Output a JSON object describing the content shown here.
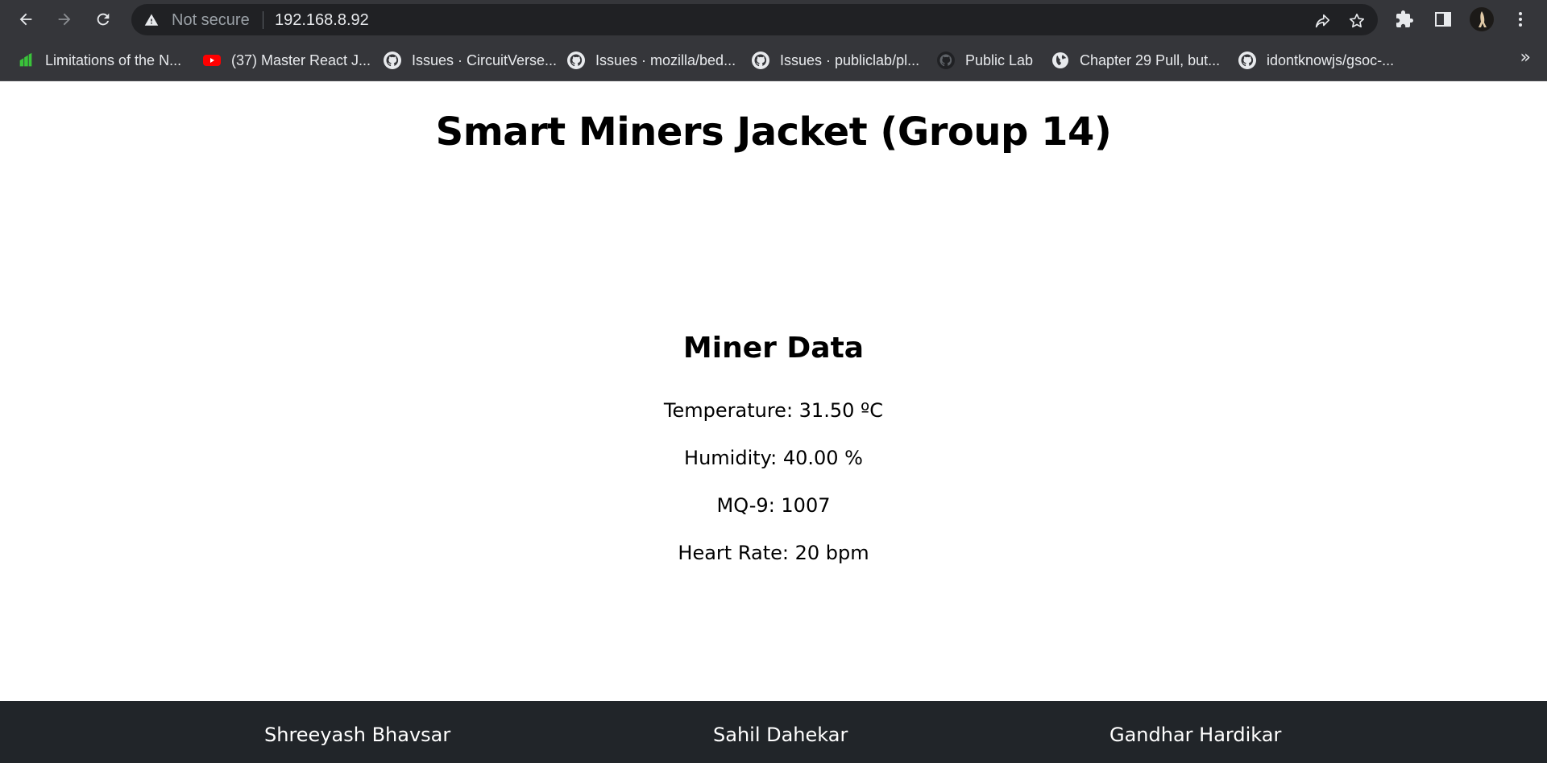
{
  "browser": {
    "security_label": "Not secure",
    "url": "192.168.8.92",
    "bookmarks": [
      {
        "label": "Limitations of the N...",
        "icon": "green-logo-icon"
      },
      {
        "label": "(37) Master React J...",
        "icon": "youtube-icon"
      },
      {
        "label": "Issues · CircuitVerse...",
        "icon": "github-icon"
      },
      {
        "label": "Issues · mozilla/bed...",
        "icon": "github-icon"
      },
      {
        "label": "Issues · publiclab/pl...",
        "icon": "github-icon"
      },
      {
        "label": "Public Lab",
        "icon": "github-icon"
      },
      {
        "label": "Chapter 29 Pull, but...",
        "icon": "globe-icon"
      },
      {
        "label": "idontknowjs/gsoc-...",
        "icon": "github-icon"
      }
    ],
    "more_bookmarks": "»",
    "colors": {
      "chrome": "#35363a",
      "omnibox": "#202124"
    }
  },
  "page": {
    "title": "Smart Miners Jacket (Group 14)",
    "section_title": "Miner Data",
    "readings": {
      "temperature": "Temperature: 31.50 ºC",
      "humidity": "Humidity: 40.00 %",
      "mq9": "MQ-9: 1007",
      "heart_rate": "Heart Rate: 20 bpm"
    }
  },
  "footer": {
    "members": [
      "Shreeyash Bhavsar",
      "Sahil Dahekar",
      "Gandhar Hardikar"
    ],
    "color": "#212529"
  }
}
